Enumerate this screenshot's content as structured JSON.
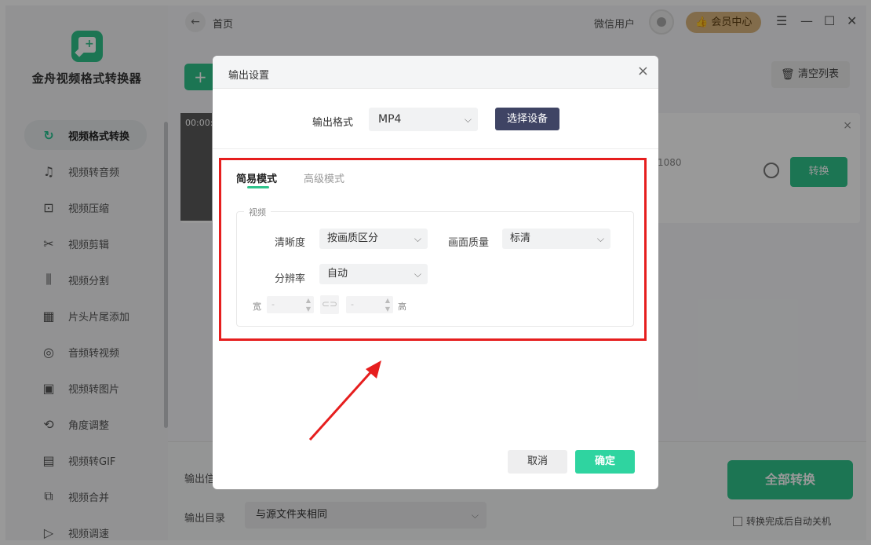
{
  "app": {
    "name": "金舟视频格式转换器"
  },
  "sidebar": {
    "items": [
      {
        "label": "视频格式转换",
        "icon": "convert-icon",
        "glyph": "↻"
      },
      {
        "label": "视频转音频",
        "icon": "audio-icon",
        "glyph": "♫"
      },
      {
        "label": "视频压缩",
        "icon": "compress-icon",
        "glyph": "⊡"
      },
      {
        "label": "视频剪辑",
        "icon": "scissors-icon",
        "glyph": "✂"
      },
      {
        "label": "视频分割",
        "icon": "split-icon",
        "glyph": "⫼"
      },
      {
        "label": "片头片尾添加",
        "icon": "film-icon",
        "glyph": "▦"
      },
      {
        "label": "音频转视频",
        "icon": "music-disc-icon",
        "glyph": "◎"
      },
      {
        "label": "视频转图片",
        "icon": "image-icon",
        "glyph": "▣"
      },
      {
        "label": "角度调整",
        "icon": "rotate-icon",
        "glyph": "⟲"
      },
      {
        "label": "视频转GIF",
        "icon": "gif-icon",
        "glyph": "▤"
      },
      {
        "label": "视频合并",
        "icon": "merge-icon",
        "glyph": "⧉"
      },
      {
        "label": "视频调速",
        "icon": "speed-icon",
        "glyph": "▷"
      }
    ]
  },
  "topbar": {
    "back": "←",
    "breadcrumb": "首页",
    "user": "微信用户",
    "vip": "会员中心",
    "vip_icon": "👍",
    "menu": "☰",
    "minimize": "—",
    "maximize": "☐",
    "close": "✕"
  },
  "main": {
    "add_label": "+",
    "clear_label": "清空列表",
    "clear_icon": "🗑",
    "card": {
      "time": "00:00:",
      "resolution": "1080",
      "convert_label": "转换",
      "close": "×"
    },
    "bottom": {
      "output_info_label": "输出信",
      "output_dir_label": "输出目录",
      "output_dir_value": "与源文件夹相同",
      "convert_all_label": "全部转换",
      "auto_shutdown_label": "转换完成后自动关机"
    }
  },
  "modal": {
    "title": "输出设置",
    "close": "×",
    "format_label": "输出格式",
    "format_value": "MP4",
    "select_device_label": "选择设备",
    "tabs": [
      {
        "label": "简易模式",
        "active": true
      },
      {
        "label": "高级模式",
        "active": false
      }
    ],
    "section_label": "视频",
    "clarity_label": "清晰度",
    "clarity_value": "按画质区分",
    "quality_label": "画面质量",
    "quality_value": "标清",
    "resolution_label": "分辨率",
    "resolution_value": "自动",
    "width_label": "宽",
    "height_label": "高",
    "width_value": "-",
    "height_value": "-",
    "cancel_label": "取消",
    "ok_label": "确定"
  },
  "colors": {
    "accent": "#2fc38b",
    "confirm": "#2fd4a0",
    "device_button": "#3f4464",
    "highlight_box": "#e61e1e",
    "vip_badge": "#d9b47d"
  }
}
